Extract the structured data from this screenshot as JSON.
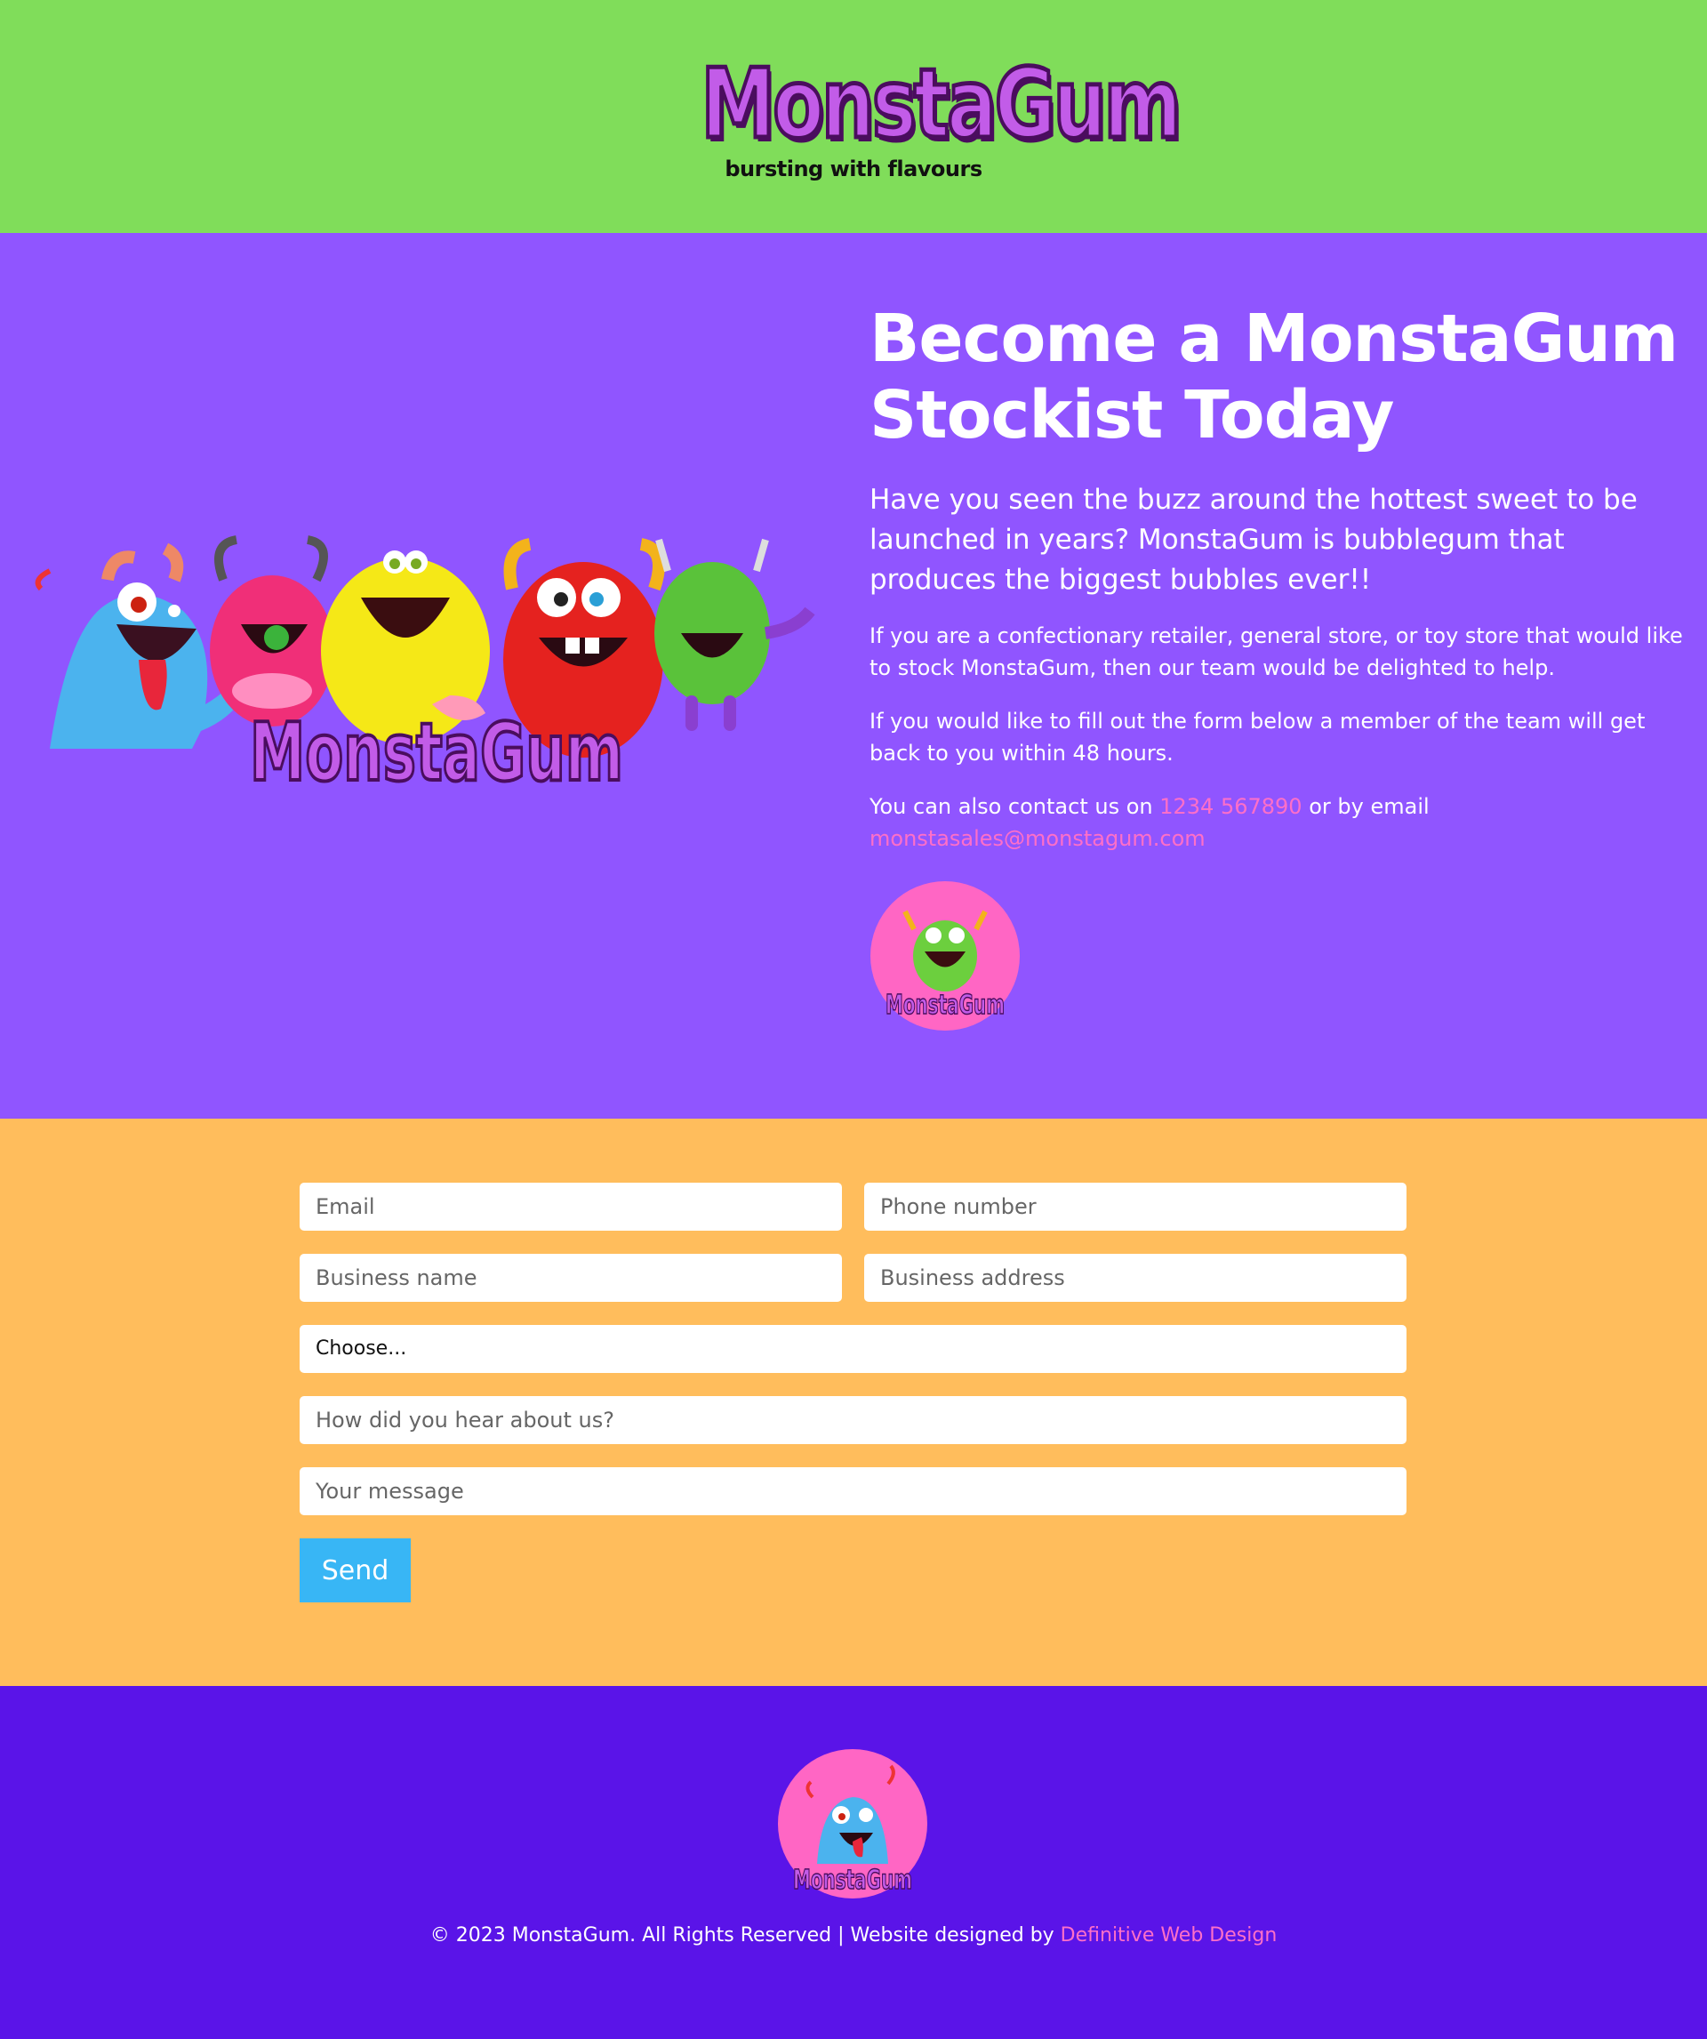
{
  "header": {
    "logo_text": "MonstaGum",
    "tagline": "bursting with flavours"
  },
  "hero": {
    "image_logo_text": "MonstaGum",
    "title": "Become a MonstaGum Stockist Today",
    "lead": "Have you seen the buzz around the hottest sweet to be launched in years? MonstaGum is bubblegum that produces the biggest bubbles ever!!",
    "para1": "If you are a confectionary retailer, general store, or toy store that would like to stock MonstaGum, then our team would be delighted to help.",
    "para2": "If you would like to fill out the form below a member of the team will get back to you within 48 hours.",
    "contact_prefix": "You can also contact us on",
    "phone": "1234 567890",
    "contact_mid": "or by email",
    "email": "monstasales@monstagum.com",
    "badge_text": "MonstaGum"
  },
  "form": {
    "email_placeholder": "Email",
    "phone_placeholder": "Phone number",
    "business_name_placeholder": "Business name",
    "business_address_placeholder": "Business address",
    "select_value": "Choose...",
    "hear_placeholder": "How did you hear about us?",
    "message_placeholder": "Your message",
    "send_label": "Send"
  },
  "footer": {
    "badge_text": "MonstaGum",
    "copyright": "© 2023 MonstaGum. All Rights Reserved | Website designed by",
    "designer_link": "Definitive Web Design"
  },
  "colors": {
    "header_bg": "#80dd5a",
    "hero_bg": "#9055ff",
    "form_bg": "#ffbd5c",
    "footer_bg": "#5a14e8",
    "accent_pink": "#ff6fc8",
    "button_blue": "#38b6f5"
  }
}
